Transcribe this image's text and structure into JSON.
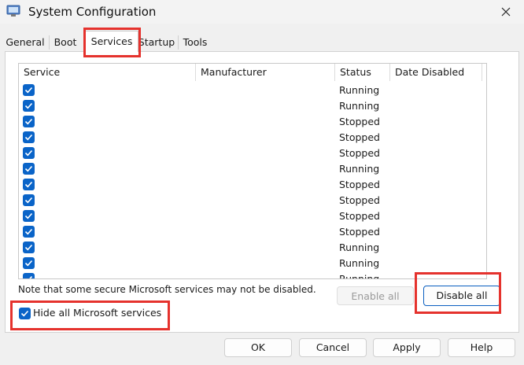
{
  "window": {
    "title": "System Configuration",
    "icon": "system-config-icon",
    "close_icon": "close-icon"
  },
  "tabs": [
    {
      "label": "General",
      "active": false
    },
    {
      "label": "Boot",
      "active": false
    },
    {
      "label": "Services",
      "active": true
    },
    {
      "label": "Startup",
      "active": false
    },
    {
      "label": "Tools",
      "active": false
    }
  ],
  "services_list": {
    "columns": [
      "Service",
      "Manufacturer",
      "Status",
      "Date Disabled"
    ],
    "rows": [
      {
        "checked": true,
        "status": "Running"
      },
      {
        "checked": true,
        "status": "Running"
      },
      {
        "checked": true,
        "status": "Stopped"
      },
      {
        "checked": true,
        "status": "Stopped"
      },
      {
        "checked": true,
        "status": "Stopped"
      },
      {
        "checked": true,
        "status": "Running"
      },
      {
        "checked": true,
        "status": "Stopped"
      },
      {
        "checked": true,
        "status": "Stopped"
      },
      {
        "checked": true,
        "status": "Stopped"
      },
      {
        "checked": true,
        "status": "Stopped"
      },
      {
        "checked": true,
        "status": "Running"
      },
      {
        "checked": true,
        "status": "Running"
      },
      {
        "checked": true,
        "status": "Running"
      }
    ]
  },
  "note": "Note that some secure Microsoft services may not be disabled.",
  "buttons": {
    "enable_all": "Enable all",
    "disable_all": "Disable all",
    "ok": "OK",
    "cancel": "Cancel",
    "apply": "Apply",
    "help": "Help"
  },
  "hide_ms": {
    "label": "Hide all Microsoft services",
    "checked": true
  },
  "colors": {
    "accent": "#0a64c8",
    "highlight": "#e5322d"
  }
}
